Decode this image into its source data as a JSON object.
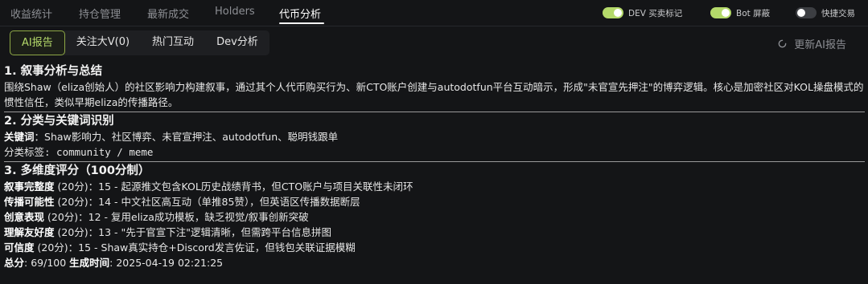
{
  "tabs": [
    "收益统计",
    "持仓管理",
    "最新成交",
    "Holders",
    "代币分析"
  ],
  "toggles": {
    "dev": "DEV 买卖标记",
    "bot": "Bot 屏蔽",
    "quick": "快捷交易"
  },
  "subtabs": [
    "AI报告",
    "关注大V(0)",
    "热门互动",
    "Dev分析"
  ],
  "refresh_label": "更新AI报告",
  "section1": {
    "title": "1. 叙事分析与总结",
    "body": "围绕Shaw（eliza创始人）的社区影响力构建叙事，通过其个人代币购买行为、新CTO账户创建与autodotfun平台互动暗示，形成\"未官宣先押注\"的博弈逻辑。核心是加密社区对KOL操盘模式的惯性信任，类似早期eliza的传播路径。"
  },
  "section2": {
    "title": "2. 分类与关键词识别",
    "kw_label": "关键词",
    "kw_text": "：Shaw影响力、社区博弈、未官宣押注、autodotfun、聪明钱跟单",
    "cat_text": "分类标签: community / meme"
  },
  "section3": {
    "title": "3. 多维度评分（100分制）",
    "rows": [
      {
        "label": "叙事完整度",
        "rest": " (20分)：15 - 起源推文包含KOL历史战绩背书，但CTO账户与项目关联性未闭环"
      },
      {
        "label": "传播可能性",
        "rest": " (20分)：14 - 中文社区高互动（单推85赞），但英语区传播数据断层"
      },
      {
        "label": "创意表现",
        "rest": " (20分)：12 - 复用eliza成功模板，缺乏视觉/叙事创新突破"
      },
      {
        "label": "理解友好度",
        "rest": " (20分)：13 - \"先于官宣下注\"逻辑清晰，但需跨平台信息拼图"
      },
      {
        "label": "可信度",
        "rest": " (20分)：15 - Shaw真实持仓+Discord发言佐证，但钱包关联证据模糊"
      }
    ],
    "total_label": "总分",
    "total_value": ": 69/100 ",
    "time_label": "生成时间",
    "time_value": ": 2025-04-19 02:21:25"
  },
  "colors": {
    "accent": "#b4d96a",
    "background": "#141517"
  }
}
